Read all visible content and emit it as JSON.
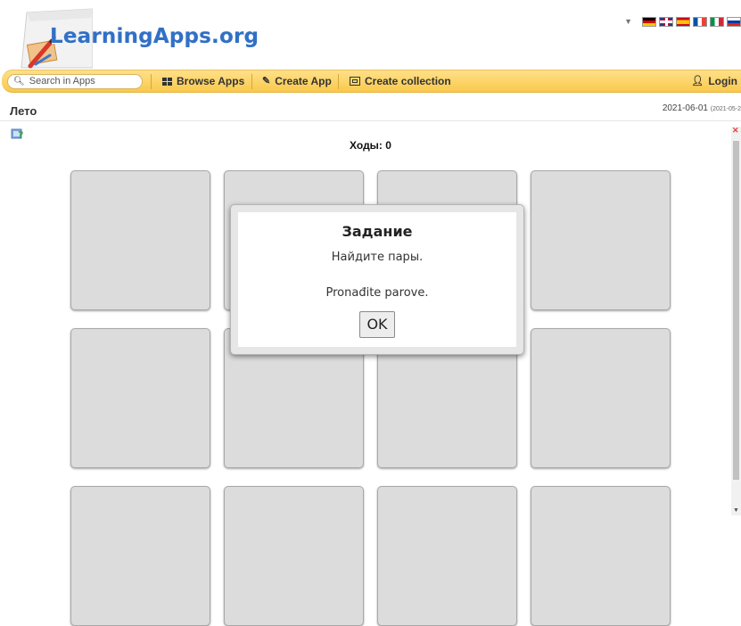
{
  "header": {
    "logo_text": "LearningApps.org",
    "languages": [
      "de",
      "gb",
      "es",
      "fr",
      "it",
      "ru"
    ]
  },
  "toolbar": {
    "search_placeholder": "Search in Apps",
    "browse_label": "Browse Apps",
    "create_app_label": "Create App",
    "create_collection_label": "Create collection",
    "login_label": "Login",
    "icons": {
      "search": "search-icon",
      "browse": "grid-icon",
      "create_app": "pencil-icon",
      "create_collection": "collection-icon",
      "login": "user-icon"
    }
  },
  "app": {
    "title": "Лето",
    "date": "2021-06-01",
    "date_small": "(2021-05-2"
  },
  "game": {
    "moves_label": "Ходы: 0",
    "card_rows_visible": 3,
    "card_cols": 4
  },
  "dialog": {
    "title": "Задание",
    "line1": "Найдите пары.",
    "line2": "Pronađite parove.",
    "ok_label": "OK"
  },
  "colors": {
    "toolbar": "#f9c94b",
    "logo": "#3170c5",
    "card": "#dcdcdc"
  }
}
